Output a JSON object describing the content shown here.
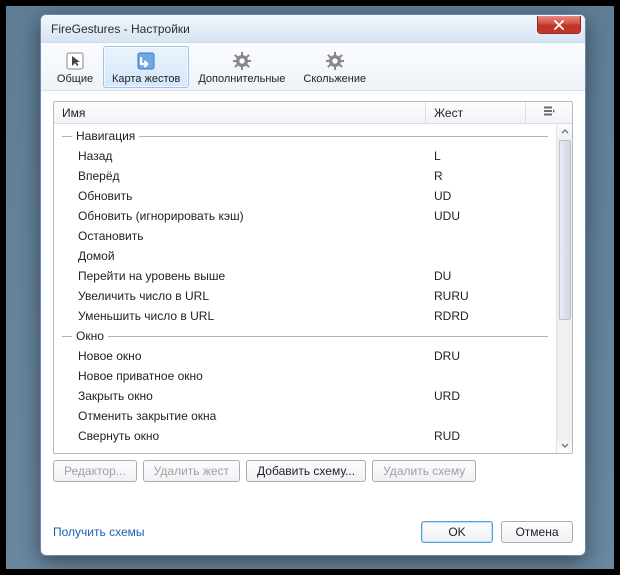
{
  "window": {
    "title": "FireGestures - Настройки"
  },
  "tabs": [
    {
      "label": "Общие"
    },
    {
      "label": "Карта жестов"
    },
    {
      "label": "Дополнительные"
    },
    {
      "label": "Скольжение"
    }
  ],
  "columns": {
    "name": "Имя",
    "gesture": "Жест"
  },
  "groups": [
    {
      "label": "Навигация",
      "rows": [
        {
          "name": "Назад",
          "gesture": "L"
        },
        {
          "name": "Вперёд",
          "gesture": "R"
        },
        {
          "name": "Обновить",
          "gesture": "UD"
        },
        {
          "name": "Обновить (игнорировать кэш)",
          "gesture": "UDU"
        },
        {
          "name": "Остановить",
          "gesture": ""
        },
        {
          "name": "Домой",
          "gesture": ""
        },
        {
          "name": "Перейти на уровень выше",
          "gesture": "DU"
        },
        {
          "name": "Увеличить число в URL",
          "gesture": "RURU"
        },
        {
          "name": "Уменьшить число в URL",
          "gesture": "RDRD"
        }
      ]
    },
    {
      "label": "Окно",
      "rows": [
        {
          "name": "Новое окно",
          "gesture": "DRU"
        },
        {
          "name": "Новое приватное окно",
          "gesture": ""
        },
        {
          "name": "Закрыть окно",
          "gesture": "URD"
        },
        {
          "name": "Отменить закрытие окна",
          "gesture": ""
        },
        {
          "name": "Свернуть окно",
          "gesture": "RUD"
        }
      ]
    }
  ],
  "buttons": {
    "editor": "Редактор...",
    "delete_gesture": "Удалить жест",
    "add_scheme": "Добавить схему...",
    "delete_scheme": "Удалить схему"
  },
  "link": "Получить схемы",
  "footer": {
    "ok": "OK",
    "cancel": "Отмена"
  }
}
